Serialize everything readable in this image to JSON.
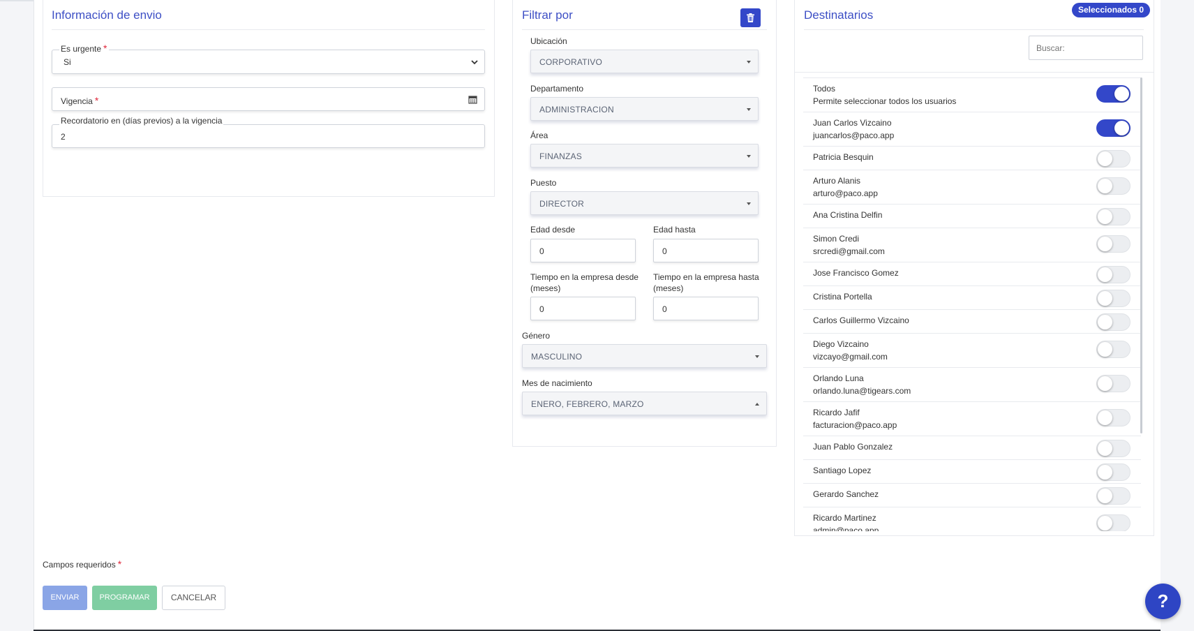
{
  "info": {
    "title": "Información de envio",
    "urgent_label": "Es urgente",
    "urgent_value": "Si",
    "vigencia_label": "Vigencia",
    "reminder_label": "Recordatorio en (días previos) a la vigencia",
    "reminder_value": "2",
    "required_mark": "*"
  },
  "filter": {
    "title": "Filtrar por",
    "ubicacion_label": "Ubicación",
    "ubicacion_value": "CORPORATIVO",
    "departamento_label": "Departamento",
    "departamento_value": "ADMINISTRACION",
    "area_label": "Área",
    "area_value": "FINANZAS",
    "puesto_label": "Puesto",
    "puesto_value": "DIRECTOR",
    "edad_desde_label": "Edad desde",
    "edad_desde_value": "0",
    "edad_hasta_label": "Edad hasta",
    "edad_hasta_value": "0",
    "tiempo_desde_label_1": "Tiempo en la empresa desde",
    "tiempo_desde_label_2": "(meses)",
    "tiempo_desde_value": "0",
    "tiempo_hasta_label_1": "Tiempo en la empresa hasta",
    "tiempo_hasta_label_2": "(meses)",
    "tiempo_hasta_value": "0",
    "genero_label": "Género",
    "genero_value": "MASCULINO",
    "mes_label": "Mes de nacimiento",
    "mes_value": "ENERO, FEBRERO, MARZO"
  },
  "recipients": {
    "title": "Destinatarios",
    "badge": "Seleccionados 0",
    "search_placeholder": "Buscar:",
    "rows": [
      {
        "name": "Todos",
        "sub": "Permite seleccionar todos los usuarios",
        "on": true
      },
      {
        "name": "Juan Carlos Vizcaino",
        "sub": "juancarlos@paco.app",
        "on": true
      },
      {
        "name": "Patricia Besquin",
        "sub": "",
        "on": false
      },
      {
        "name": "Arturo Alanis",
        "sub": "arturo@paco.app",
        "on": false
      },
      {
        "name": "Ana Cristina Delfin",
        "sub": "",
        "on": false
      },
      {
        "name": "Simon Credi",
        "sub": "srcredi@gmail.com",
        "on": false
      },
      {
        "name": "Jose Francisco Gomez",
        "sub": "",
        "on": false
      },
      {
        "name": "Cristina Portella",
        "sub": "",
        "on": false
      },
      {
        "name": "Carlos Guillermo Vizcaino",
        "sub": "",
        "on": false
      },
      {
        "name": "Diego Vizcaino",
        "sub": "vizcayo@gmail.com",
        "on": false
      },
      {
        "name": "Orlando Luna",
        "sub": "orlando.luna@tigears.com",
        "on": false
      },
      {
        "name": "Ricardo Jafif",
        "sub": "facturacion@paco.app",
        "on": false
      },
      {
        "name": "Juan Pablo Gonzalez",
        "sub": "",
        "on": false
      },
      {
        "name": "Santiago Lopez",
        "sub": "",
        "on": false
      },
      {
        "name": "Gerardo Sanchez",
        "sub": "",
        "on": false
      },
      {
        "name": "Ricardo Martinez",
        "sub": "admin@paco.app",
        "on": false
      }
    ]
  },
  "footer": {
    "required_note": "Campos requeridos",
    "send_label": "ENVIAR",
    "schedule_label": "PROGRAMAR",
    "cancel_label": "CANCELAR",
    "help_label": "?"
  }
}
